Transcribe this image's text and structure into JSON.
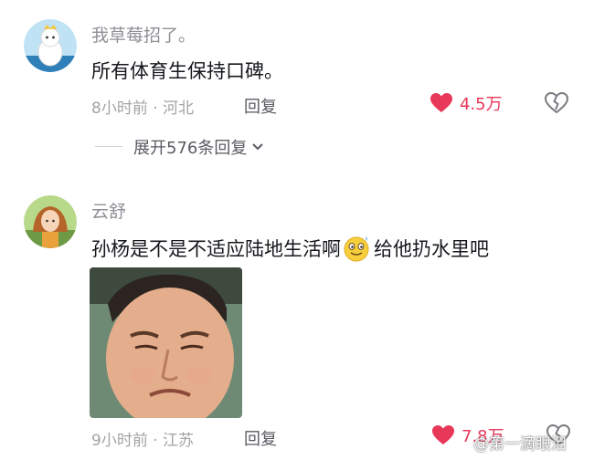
{
  "comments": [
    {
      "username": "我草莓招了。",
      "text": "所有体育生保持口碑。",
      "time": "8小时前",
      "location": "河北",
      "reply_label": "回复",
      "likes": "4.5万",
      "expand_label": "展开576条回复"
    },
    {
      "username": "云舒",
      "text_before_emoji": "孙杨是不是不适应陆地生活啊",
      "text_after_emoji": "给他扔水里吧",
      "time": "9小时前",
      "location": "江苏",
      "reply_label": "回复",
      "likes": "7.8万"
    }
  ],
  "watermark": "@第一滴眼泪",
  "icons": {
    "like": "heart-filled-icon",
    "dislike": "broken-heart-icon",
    "expand": "chevron-down-icon",
    "emoji": "smiley-emoji-icon"
  },
  "colors": {
    "like_red": "#e8385a",
    "username_gray": "#8f8f96",
    "text_dark": "#16181d"
  }
}
